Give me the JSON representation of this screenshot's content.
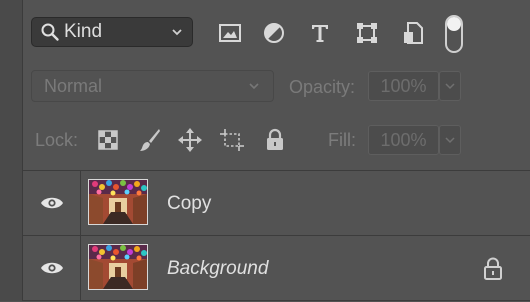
{
  "filter": {
    "kind_label": "Kind",
    "icons": [
      "image-filter-icon",
      "adjustment-filter-icon",
      "type-filter-icon",
      "shape-filter-icon",
      "smart-object-filter-icon",
      "filter-toggle-switch"
    ]
  },
  "blend": {
    "mode": "Normal",
    "opacity_label": "Opacity:",
    "opacity_value": "100%"
  },
  "lock": {
    "label": "Lock:",
    "fill_label": "Fill:",
    "fill_value": "100%"
  },
  "layers": [
    {
      "name": "Copy",
      "visible": true,
      "locked": false
    },
    {
      "name": "Background",
      "visible": true,
      "locked": true
    }
  ]
}
